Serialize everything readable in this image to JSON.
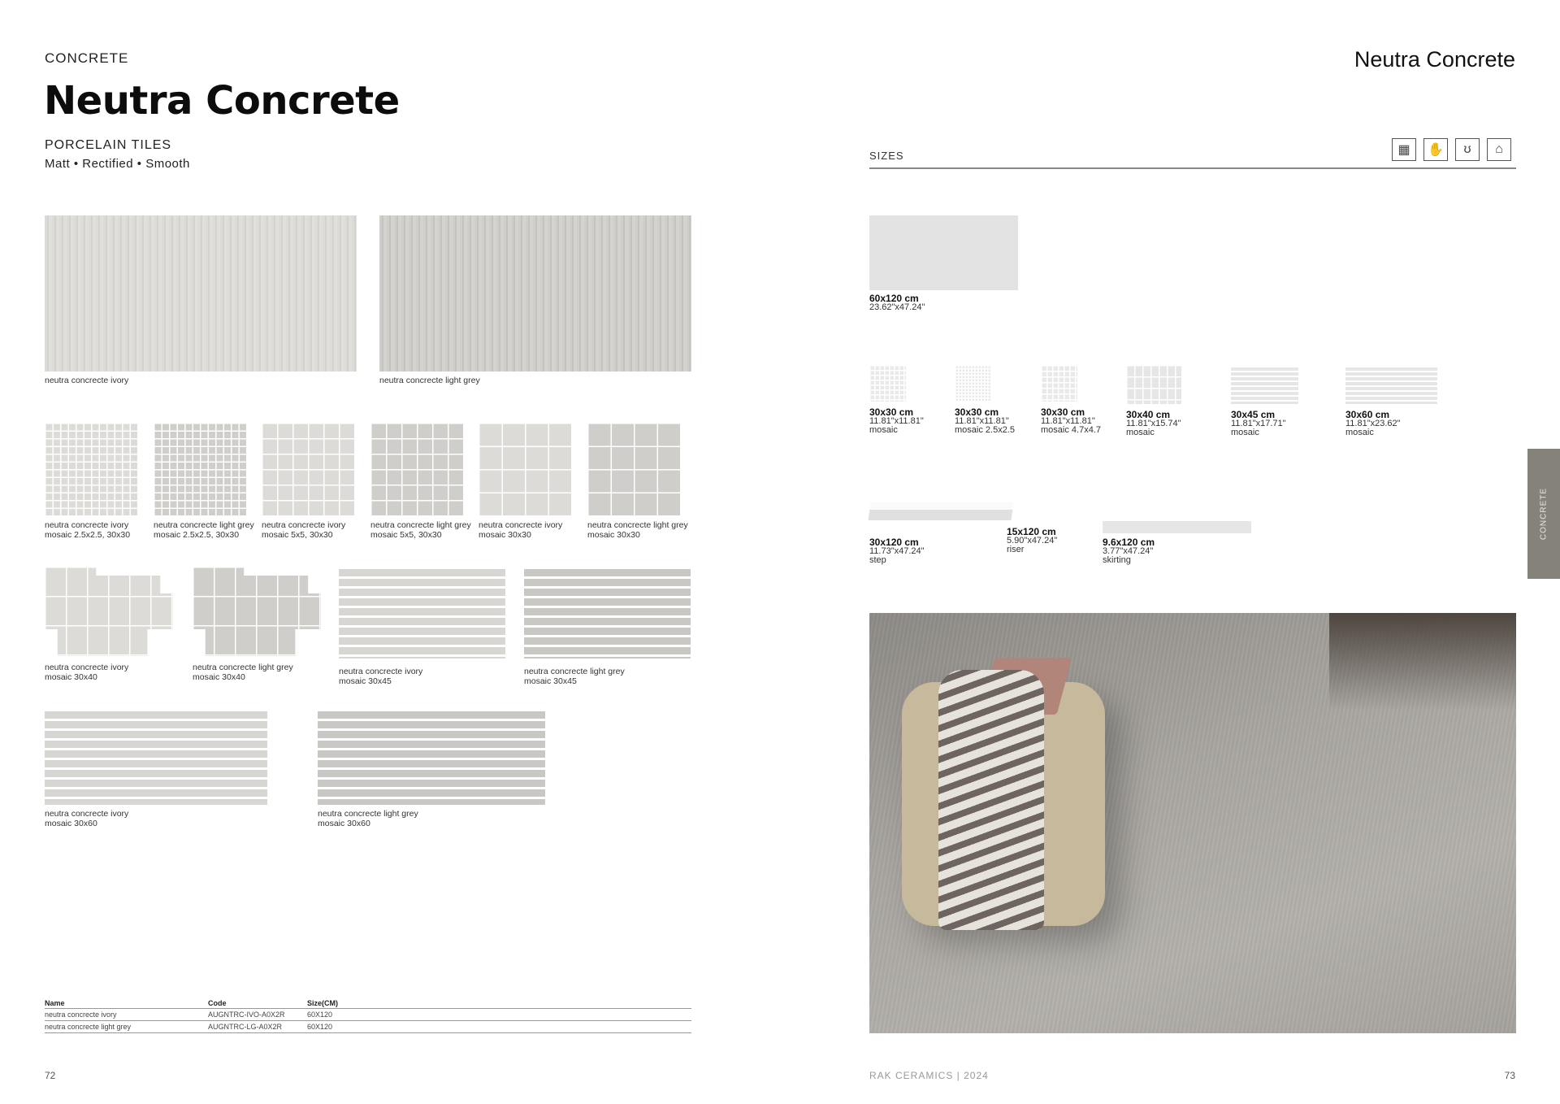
{
  "left_page": {
    "category": "CONCRETE",
    "title": "Neutra Concrete",
    "subtitle": "PORCELAIN TILES",
    "finish": "Matt • Rectified • Smooth",
    "main_tiles": [
      {
        "name": "neutra concrecte ivory"
      },
      {
        "name": "neutra concrecte light grey"
      }
    ],
    "mosaics_row1": [
      {
        "line1": "neutra concrecte ivory",
        "line2": "mosaic 2.5x2.5, 30x30"
      },
      {
        "line1": "neutra concrecte light grey",
        "line2": "mosaic 2.5x2.5, 30x30"
      },
      {
        "line1": "neutra concrecte ivory",
        "line2": "mosaic 5x5, 30x30"
      },
      {
        "line1": "neutra concrecte light grey",
        "line2": "mosaic 5x5, 30x30"
      },
      {
        "line1": "neutra concrecte ivory",
        "line2": "mosaic 30x30"
      },
      {
        "line1": "neutra concrecte light grey",
        "line2": "mosaic 30x30"
      }
    ],
    "mosaics_row2": [
      {
        "line1": "neutra concrecte ivory",
        "line2": "mosaic 30x40"
      },
      {
        "line1": "neutra concrecte light grey",
        "line2": "mosaic 30x40"
      },
      {
        "line1": "neutra concrecte ivory",
        "line2": "mosaic 30x45"
      },
      {
        "line1": "neutra concrecte light grey",
        "line2": "mosaic 30x45"
      }
    ],
    "mosaics_row3": [
      {
        "line1": "neutra concrecte ivory",
        "line2": "mosaic 30x60"
      },
      {
        "line1": "neutra concrecte light grey",
        "line2": "mosaic 30x60"
      }
    ],
    "table": {
      "headers": [
        "Name",
        "Code",
        "Size(CM)"
      ],
      "rows": [
        [
          "neutra concrecte ivory",
          "AUGNTRC-IVO-A0X2R",
          "60X120"
        ],
        [
          "neutra concrecte light grey",
          "AUGNTRC-LG-A0X2R",
          "60X120"
        ]
      ]
    },
    "page_number": "72"
  },
  "right_page": {
    "header_title": "Neutra Concrete",
    "sizes_label": "SIZES",
    "icons": [
      "floor-wall-pattern-icon",
      "hand-touch-icon",
      "footprints-icon",
      "home-icon"
    ],
    "main_size": {
      "cm": "60x120 cm",
      "inch": "23.62\"x47.24\""
    },
    "mosaic_sizes": [
      {
        "cm": "30x30 cm",
        "inch": "11.81\"x11.81\"",
        "type": "mosaic"
      },
      {
        "cm": "30x30 cm",
        "inch": "11.81\"x11.81\"",
        "type": "mosaic 2.5x2.5"
      },
      {
        "cm": "30x30 cm",
        "inch": "11.81\"x11.81\"",
        "type": "mosaic 4.7x4.7"
      },
      {
        "cm": "30x40 cm",
        "inch": "11.81\"x15.74\"",
        "type": "mosaic"
      },
      {
        "cm": "30x45 cm",
        "inch": "11.81\"x17.71\"",
        "type": "mosaic"
      },
      {
        "cm": "30x60 cm",
        "inch": "11.81\"x23.62\"",
        "type": "mosaic"
      }
    ],
    "trim_sizes": [
      {
        "cm": "30x120 cm",
        "inch": "11.73\"x47.24\"",
        "type": "step"
      },
      {
        "cm": "15x120 cm",
        "inch": "5.90\"x47.24\"",
        "type": "riser"
      },
      {
        "cm": "9.6x120 cm",
        "inch": "3.77\"x47.24\"",
        "type": "skirting"
      }
    ],
    "side_tab": "CONCRETE",
    "footer_brand": "RAK CERAMICS | 2024",
    "page_number": "73"
  }
}
